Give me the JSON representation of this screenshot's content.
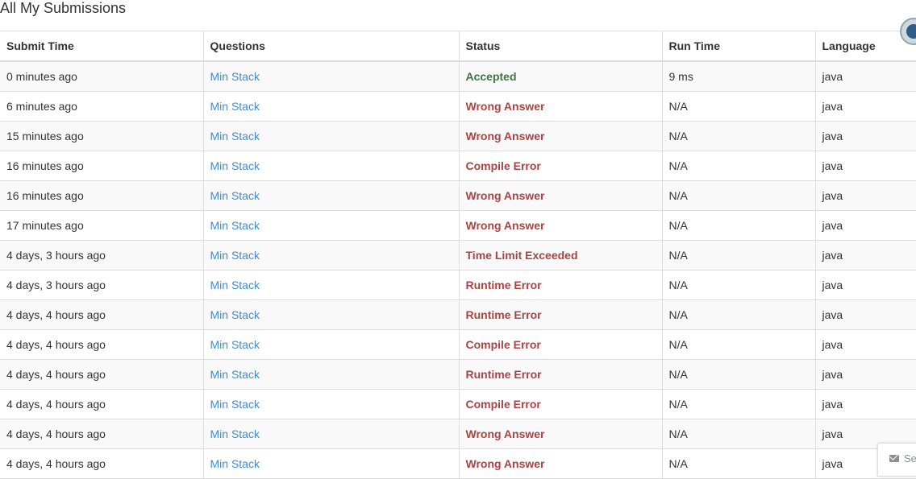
{
  "page": {
    "title": "All My Submissions"
  },
  "table": {
    "headers": [
      "Submit Time",
      "Questions",
      "Status",
      "Run Time",
      "Language"
    ],
    "rows": [
      {
        "time": "0 minutes ago",
        "question": "Min Stack",
        "status": "Accepted",
        "status_kind": "accepted",
        "runtime": "9 ms",
        "language": "java"
      },
      {
        "time": "6 minutes ago",
        "question": "Min Stack",
        "status": "Wrong Answer",
        "status_kind": "failed",
        "runtime": "N/A",
        "language": "java"
      },
      {
        "time": "15 minutes ago",
        "question": "Min Stack",
        "status": "Wrong Answer",
        "status_kind": "failed",
        "runtime": "N/A",
        "language": "java"
      },
      {
        "time": "16 minutes ago",
        "question": "Min Stack",
        "status": "Compile Error",
        "status_kind": "failed",
        "runtime": "N/A",
        "language": "java"
      },
      {
        "time": "16 minutes ago",
        "question": "Min Stack",
        "status": "Wrong Answer",
        "status_kind": "failed",
        "runtime": "N/A",
        "language": "java"
      },
      {
        "time": "17 minutes ago",
        "question": "Min Stack",
        "status": "Wrong Answer",
        "status_kind": "failed",
        "runtime": "N/A",
        "language": "java"
      },
      {
        "time": "4 days, 3 hours ago",
        "question": "Min Stack",
        "status": "Time Limit Exceeded",
        "status_kind": "failed",
        "runtime": "N/A",
        "language": "java"
      },
      {
        "time": "4 days, 3 hours ago",
        "question": "Min Stack",
        "status": "Runtime Error",
        "status_kind": "failed",
        "runtime": "N/A",
        "language": "java"
      },
      {
        "time": "4 days, 4 hours ago",
        "question": "Min Stack",
        "status": "Runtime Error",
        "status_kind": "failed",
        "runtime": "N/A",
        "language": "java"
      },
      {
        "time": "4 days, 4 hours ago",
        "question": "Min Stack",
        "status": "Compile Error",
        "status_kind": "failed",
        "runtime": "N/A",
        "language": "java"
      },
      {
        "time": "4 days, 4 hours ago",
        "question": "Min Stack",
        "status": "Runtime Error",
        "status_kind": "failed",
        "runtime": "N/A",
        "language": "java"
      },
      {
        "time": "4 days, 4 hours ago",
        "question": "Min Stack",
        "status": "Compile Error",
        "status_kind": "failed",
        "runtime": "N/A",
        "language": "java"
      },
      {
        "time": "4 days, 4 hours ago",
        "question": "Min Stack",
        "status": "Wrong Answer",
        "status_kind": "failed",
        "runtime": "N/A",
        "language": "java"
      },
      {
        "time": "4 days, 4 hours ago",
        "question": "Min Stack",
        "status": "Wrong Answer",
        "status_kind": "failed",
        "runtime": "N/A",
        "language": "java"
      }
    ]
  },
  "corner_avatar": {
    "icon": "avatar-icon"
  },
  "feedback": {
    "label": "Se",
    "icon": "envelope-icon"
  },
  "colors": {
    "link": "#428bca",
    "accepted": "#3c763d",
    "failed": "#a94442",
    "stripe": "#f9f9f9",
    "border": "#dddddd"
  }
}
